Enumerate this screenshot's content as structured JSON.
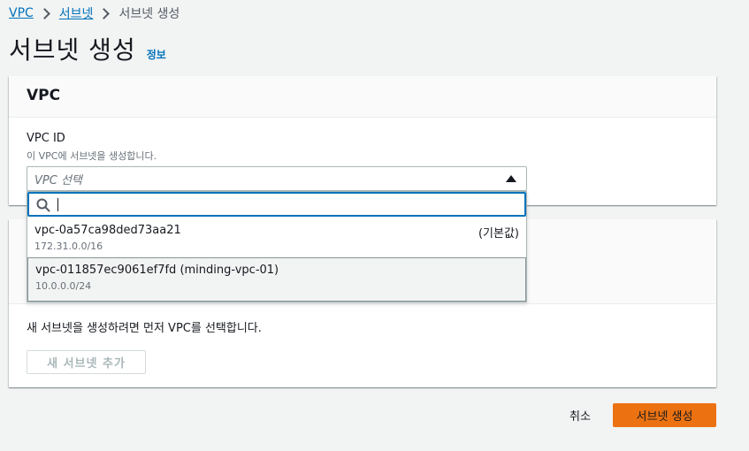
{
  "breadcrumb": {
    "items": [
      {
        "label": "VPC"
      },
      {
        "label": "서브넷"
      },
      {
        "label": "서브넷 생성"
      }
    ]
  },
  "page": {
    "title": "서브넷 생성",
    "info_link": "정보"
  },
  "vpc_section": {
    "header": "VPC",
    "field_label": "VPC ID",
    "field_description": "이 VPC에 서브넷을 생성합니다.",
    "select_placeholder": "VPC 선택"
  },
  "dropdown": {
    "search_value": "",
    "options": [
      {
        "label": "vpc-0a57ca98ded73aa21",
        "cidr": "172.31.0.0/16",
        "tag": "(기본값)"
      },
      {
        "label": "vpc-011857ec9061ef7fd (minding-vpc-01)",
        "cidr": "10.0.0.0/24",
        "tag": ""
      }
    ]
  },
  "subnet_section": {
    "empty_message": "새 서브넷을 생성하려면 먼저 VPC를 선택합니다.",
    "add_button": "새 서브넷 추가"
  },
  "footer": {
    "cancel_label": "취소",
    "create_label": "서브넷 생성"
  },
  "colors": {
    "link": "#0073bb",
    "primary_button": "#ec7211",
    "focus_border": "#0073bb"
  },
  "icons": {
    "breadcrumb_separator": "chevron-right-icon",
    "select_caret": "caret-up-icon",
    "search": "search-icon"
  }
}
